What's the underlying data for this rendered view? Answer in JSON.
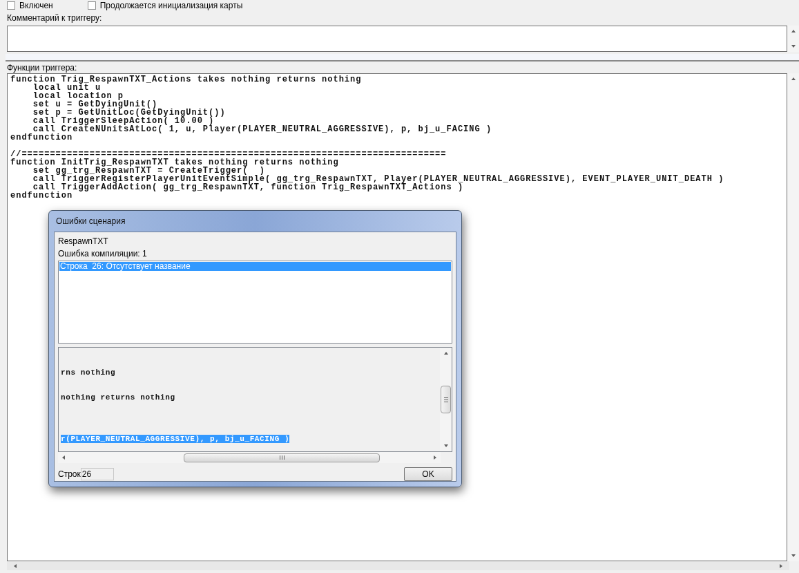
{
  "checkboxes": [
    {
      "label": "Включен",
      "checked": false
    },
    {
      "label": "Продолжается инициализация карты",
      "checked": false
    }
  ],
  "comment": {
    "label": "Комментарий к триггеру:"
  },
  "functions": {
    "label": "Функции триггера:",
    "code": "function Trig_RespawnTXT_Actions takes nothing returns nothing\n    local unit u\n    local location p\n    set u = GetDyingUnit()\n    set p = GetUnitLoc(GetDyingUnit())\n    call TriggerSleepAction( 10.00 )\n    call CreateNUnitsAtLoc( 1, u, Player(PLAYER_NEUTRAL_AGGRESSIVE), p, bj_u_FACING )\nendfunction\n\n//===========================================================================\nfunction InitTrig_RespawnTXT takes nothing returns nothing\n    set gg_trg_RespawnTXT = CreateTrigger(  )\n    call TriggerRegisterPlayerUnitEventSimple( gg_trg_RespawnTXT, Player(PLAYER_NEUTRAL_AGGRESSIVE), EVENT_PLAYER_UNIT_DEATH )\n    call TriggerAddAction( gg_trg_RespawnTXT, function Trig_RespawnTXT_Actions )\nendfunction"
  },
  "dialog": {
    "title": "Ошибки сценария",
    "trigger_name": "RespawnTXT",
    "error_count": "Ошибка компиляции: 1",
    "errors": [
      {
        "text": "Строка  26: Отсутствует название",
        "selected": true
      }
    ],
    "preview": {
      "text": "\n\nrns nothing\n\n\nnothing returns nothing\n\n\n\n\n",
      "highlighted_line": {
        "text": "r(PLAYER_NEUTRAL_AGGRESSIVE), p, bj_u_FACING )",
        "selected": true
      }
    },
    "line_label": "Строк",
    "line_value": "26",
    "ok_button": "OK"
  }
}
